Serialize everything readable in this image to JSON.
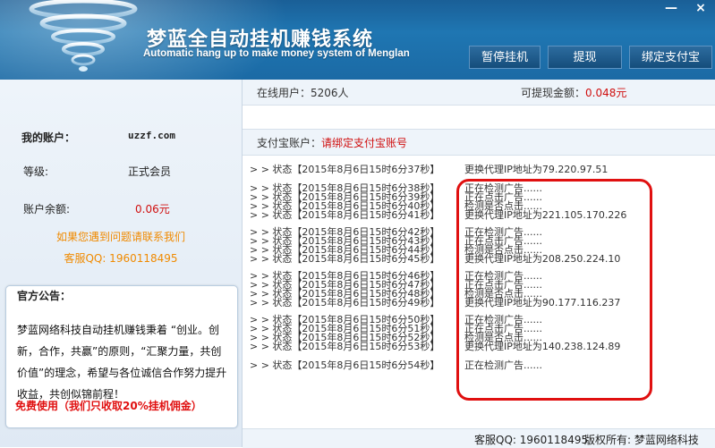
{
  "header": {
    "title": "梦蓝全自动挂机赚钱系统",
    "subtitle": "Automatic hang up to make money system of Menglan",
    "minimize": "—",
    "close": "×",
    "buttons": {
      "pause": "暂停挂机",
      "withdraw": "提现",
      "bind": "绑定支付宝"
    }
  },
  "sidebar": {
    "account_label": "我的账户：",
    "account_value": "uzzf.com",
    "level_label": "等级:",
    "level_value": "正式会员",
    "balance_label": "账户余额:",
    "balance_value": "0.06元",
    "help_text": "如果您遇到问题请联系我们",
    "qq_text": "客服QQ: 1960118495",
    "notice": {
      "title": "官方公告：",
      "body": "梦蓝网络科技自动挂机赚钱秉着  “创业。创新，合作，共赢”的原则，“汇聚力量，共创价值”的理念，希望与各位诚信合作努力提升收益，共创似锦前程！",
      "free": "免费使用（我们只收取20%挂机佣金）"
    }
  },
  "main": {
    "online": "在线用户：5206人",
    "withdrawable_label": "可提现金额：",
    "withdrawable_value": "0.048元",
    "alipay_label": "支付宝账户：",
    "alipay_value": "请绑定支付宝账号",
    "log": [
      {
        "lines": [
          {
            "status": "> > 状态【2015年8月6日15时6分37秒】",
            "msg": "更换代理IP地址为79.220.97.51"
          }
        ]
      },
      {
        "lines": [
          {
            "status": "> > 状态【2015年8月6日15时6分38秒】",
            "msg": "正在检测广告......"
          },
          {
            "status": "> > 状态【2015年8月6日15时6分39秒】",
            "msg": "正在点击广告......"
          },
          {
            "status": "> > 状态【2015年8月6日15时6分40秒】",
            "msg": "检测是否点击......"
          },
          {
            "status": "> > 状态【2015年8月6日15时6分41秒】",
            "msg": "更换代理IP地址为221.105.170.226"
          }
        ]
      },
      {
        "lines": [
          {
            "status": "> > 状态【2015年8月6日15时6分42秒】",
            "msg": "正在检测广告......"
          },
          {
            "status": "> > 状态【2015年8月6日15时6分43秒】",
            "msg": "正在点击广告......"
          },
          {
            "status": "> > 状态【2015年8月6日15时6分44秒】",
            "msg": "检测是否点击......"
          },
          {
            "status": "> > 状态【2015年8月6日15时6分45秒】",
            "msg": "更换代理IP地址为208.250.224.10"
          }
        ]
      },
      {
        "lines": [
          {
            "status": "> > 状态【2015年8月6日15时6分46秒】",
            "msg": "正在检测广告......"
          },
          {
            "status": "> > 状态【2015年8月6日15时6分47秒】",
            "msg": "正在点击广告......"
          },
          {
            "status": "> > 状态【2015年8月6日15时6分48秒】",
            "msg": "检测是否点击......"
          },
          {
            "status": "> > 状态【2015年8月6日15时6分49秒】",
            "msg": "更换代理IP地址为90.177.116.237"
          }
        ]
      },
      {
        "lines": [
          {
            "status": "> > 状态【2015年8月6日15时6分50秒】",
            "msg": "正在检测广告......"
          },
          {
            "status": "> > 状态【2015年8月6日15时6分51秒】",
            "msg": "正在点击广告......"
          },
          {
            "status": "> > 状态【2015年8月6日15时6分52秒】",
            "msg": "检测是否点击......"
          },
          {
            "status": "> > 状态【2015年8月6日15时6分53秒】",
            "msg": "更换代理IP地址为140.238.124.89"
          }
        ]
      },
      {
        "lines": [
          {
            "status": "> > 状态【2015年8月6日15时6分54秒】",
            "msg": "正在检测广告......"
          }
        ]
      }
    ]
  },
  "footer": {
    "qq": "客服QQ: 1960118495",
    "copyright": "版权所有: 梦蓝网络科技"
  },
  "colors": {
    "header_blue": "#1f76b2",
    "accent_red": "#d01010",
    "orange": "#f08a00",
    "highlight_red": "#e01010"
  }
}
